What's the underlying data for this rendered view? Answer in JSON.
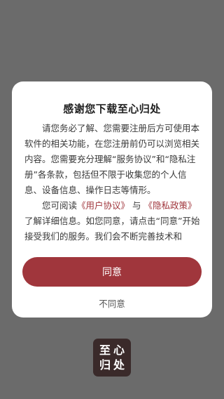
{
  "dialog": {
    "title": "感谢您下载至心归处",
    "body": {
      "para1": "请您务必了解、您需要注册后方可使用本软件的相关功能，在您注册前仍可以浏览相关内容。您需要充分理解“服务协议”和“隐私注册”各条款，包括但不限于收集您的个人信息、设备信息、操作日志等情形。",
      "para2_prefix": "您可阅读",
      "user_agreement_link": "《用户协议》",
      "para2_and": "与",
      "privacy_policy_link": "《隐私政策》",
      "para2_suffix": "了解详细信息。如您同意，请点击“同意”开始接受我们的服务。我们会不断完善技术和"
    },
    "agree_label": "同意",
    "disagree_label": "不同意"
  },
  "app_logo": {
    "chars": [
      "至",
      "心",
      "归",
      "处"
    ]
  },
  "colors": {
    "background": "#6b6b6b",
    "accent": "#a0363c",
    "logo_bg": "#3a2a2a"
  }
}
